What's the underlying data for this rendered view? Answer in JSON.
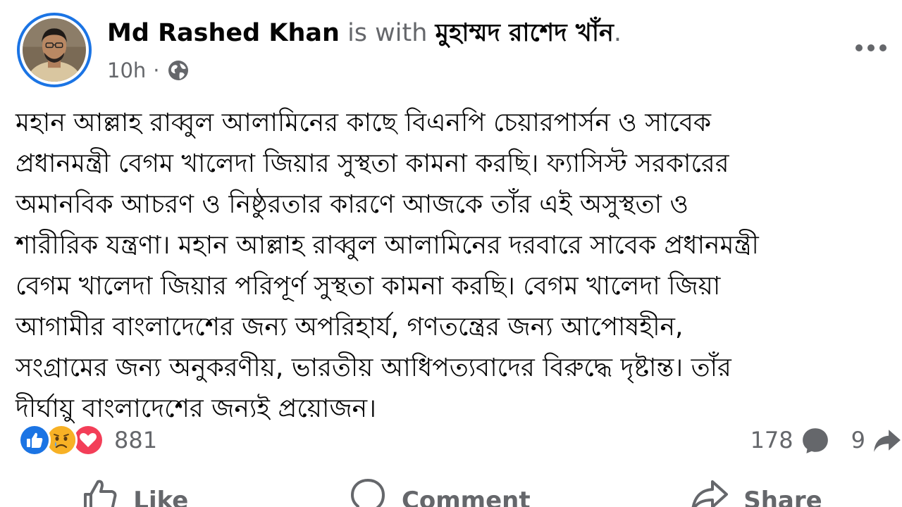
{
  "post": {
    "author": "Md Rashed Khan",
    "with_text": "is with",
    "tagged": "মুহাম্মদ রাশেদ খাঁন",
    "tagged_suffix": ".",
    "time": "10h",
    "separator": "·",
    "privacy_icon": "globe-icon",
    "more_icon": "more-options-icon",
    "text_lines": [
      "মহান আল্লাহ রাব্বুল আলামিনের কাছে বিএনপি চেয়ারপার্সন ও সাবেক",
      "প্রধানমন্ত্রী বেগম খালেদা জিয়ার সুস্থতা কামনা করছি। ফ্যাসিস্ট সরকারের",
      "অমানবিক আচরণ ও নিষ্ঠুরতার কারণে আজকে তাঁর এই অসুস্থতা ও",
      "শারীরিক যন্ত্রণা। মহান আল্লাহ রাব্বুল আলামিনের দরবারে  সাবেক প্রধানমন্ত্রী",
      "বেগম খালেদা জিয়ার পরিপূর্ণ সুস্থতা কামনা করছি। বেগম খালেদা জিয়া",
      "আগামীর বাংলাদেশের জন্য অপরিহার্য, গণতন্ত্রের জন্য আপোষহীন,",
      "সংগ্রামের জন্য অনুকরণীয়, ভারতীয় আধিপত্যবাদের বিরুদ্ধে দৃষ্টান্ত। তাঁর",
      "দীর্ঘায়ু বাংলাদেশের জন্যই প্রয়োজন।"
    ]
  },
  "reactions": {
    "icons": [
      "like-reaction-icon",
      "sad-reaction-icon",
      "love-reaction-icon"
    ],
    "count": "881"
  },
  "stats": {
    "comments": "178",
    "shares": "9"
  },
  "actions": {
    "like": "Like",
    "comment": "Comment",
    "share": "Share"
  },
  "colors": {
    "brand_blue": "#1b74e4",
    "secondary_text": "#65676b",
    "love_red": "#f33e58",
    "haha_yellow": "#f7b125"
  }
}
